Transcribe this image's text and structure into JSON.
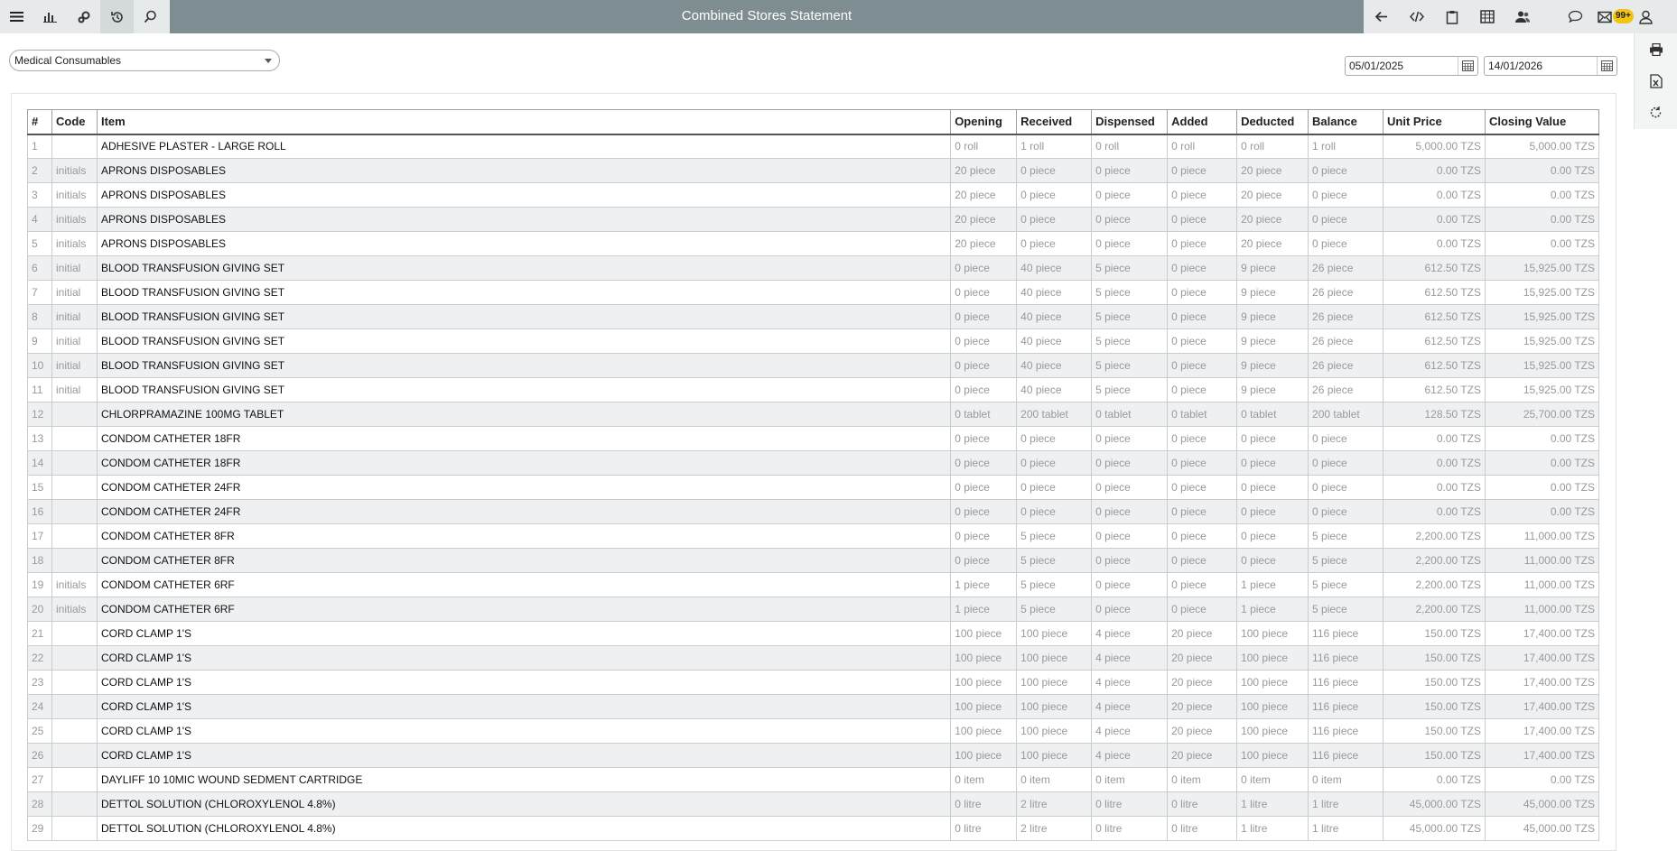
{
  "header": {
    "title": "Combined Stores Statement",
    "notification_count": "99+"
  },
  "filters": {
    "store": "Medical Consumables",
    "date_from": "05/01/2025",
    "date_to": "14/01/2026"
  },
  "table": {
    "columns": [
      "#",
      "Code",
      "Item",
      "Opening",
      "Received",
      "Dispensed",
      "Added",
      "Deducted",
      "Balance",
      "Unit Price",
      "Closing Value"
    ],
    "rows": [
      [
        "1",
        "",
        "ADHESIVE PLASTER - LARGE ROLL",
        "0 roll",
        "1 roll",
        "0 roll",
        "0 roll",
        "0 roll",
        "1 roll",
        "5,000.00 TZS",
        "5,000.00 TZS"
      ],
      [
        "2",
        "initials",
        "APRONS DISPOSABLES",
        "20 piece",
        "0 piece",
        "0 piece",
        "0 piece",
        "20 piece",
        "0 piece",
        "0.00 TZS",
        "0.00 TZS"
      ],
      [
        "3",
        "initials",
        "APRONS DISPOSABLES",
        "20 piece",
        "0 piece",
        "0 piece",
        "0 piece",
        "20 piece",
        "0 piece",
        "0.00 TZS",
        "0.00 TZS"
      ],
      [
        "4",
        "initials",
        "APRONS DISPOSABLES",
        "20 piece",
        "0 piece",
        "0 piece",
        "0 piece",
        "20 piece",
        "0 piece",
        "0.00 TZS",
        "0.00 TZS"
      ],
      [
        "5",
        "initials",
        "APRONS DISPOSABLES",
        "20 piece",
        "0 piece",
        "0 piece",
        "0 piece",
        "20 piece",
        "0 piece",
        "0.00 TZS",
        "0.00 TZS"
      ],
      [
        "6",
        "initial",
        "BLOOD TRANSFUSION GIVING SET",
        "0 piece",
        "40 piece",
        "5 piece",
        "0 piece",
        "9 piece",
        "26 piece",
        "612.50 TZS",
        "15,925.00 TZS"
      ],
      [
        "7",
        "initial",
        "BLOOD TRANSFUSION GIVING SET",
        "0 piece",
        "40 piece",
        "5 piece",
        "0 piece",
        "9 piece",
        "26 piece",
        "612.50 TZS",
        "15,925.00 TZS"
      ],
      [
        "8",
        "initial",
        "BLOOD TRANSFUSION GIVING SET",
        "0 piece",
        "40 piece",
        "5 piece",
        "0 piece",
        "9 piece",
        "26 piece",
        "612.50 TZS",
        "15,925.00 TZS"
      ],
      [
        "9",
        "initial",
        "BLOOD TRANSFUSION GIVING SET",
        "0 piece",
        "40 piece",
        "5 piece",
        "0 piece",
        "9 piece",
        "26 piece",
        "612.50 TZS",
        "15,925.00 TZS"
      ],
      [
        "10",
        "initial",
        "BLOOD TRANSFUSION GIVING SET",
        "0 piece",
        "40 piece",
        "5 piece",
        "0 piece",
        "9 piece",
        "26 piece",
        "612.50 TZS",
        "15,925.00 TZS"
      ],
      [
        "11",
        "initial",
        "BLOOD TRANSFUSION GIVING SET",
        "0 piece",
        "40 piece",
        "5 piece",
        "0 piece",
        "9 piece",
        "26 piece",
        "612.50 TZS",
        "15,925.00 TZS"
      ],
      [
        "12",
        "",
        "CHLORPRAMAZINE 100MG TABLET",
        "0 tablet",
        "200 tablet",
        "0 tablet",
        "0 tablet",
        "0 tablet",
        "200 tablet",
        "128.50 TZS",
        "25,700.00 TZS"
      ],
      [
        "13",
        "",
        "CONDOM CATHETER 18FR",
        "0 piece",
        "0 piece",
        "0 piece",
        "0 piece",
        "0 piece",
        "0 piece",
        "0.00 TZS",
        "0.00 TZS"
      ],
      [
        "14",
        "",
        "CONDOM CATHETER 18FR",
        "0 piece",
        "0 piece",
        "0 piece",
        "0 piece",
        "0 piece",
        "0 piece",
        "0.00 TZS",
        "0.00 TZS"
      ],
      [
        "15",
        "",
        "CONDOM CATHETER 24FR",
        "0 piece",
        "0 piece",
        "0 piece",
        "0 piece",
        "0 piece",
        "0 piece",
        "0.00 TZS",
        "0.00 TZS"
      ],
      [
        "16",
        "",
        "CONDOM CATHETER 24FR",
        "0 piece",
        "0 piece",
        "0 piece",
        "0 piece",
        "0 piece",
        "0 piece",
        "0.00 TZS",
        "0.00 TZS"
      ],
      [
        "17",
        "",
        "CONDOM CATHETER 8FR",
        "0 piece",
        "5 piece",
        "0 piece",
        "0 piece",
        "0 piece",
        "5 piece",
        "2,200.00 TZS",
        "11,000.00 TZS"
      ],
      [
        "18",
        "",
        "CONDOM CATHETER 8FR",
        "0 piece",
        "5 piece",
        "0 piece",
        "0 piece",
        "0 piece",
        "5 piece",
        "2,200.00 TZS",
        "11,000.00 TZS"
      ],
      [
        "19",
        "initials",
        "CONDOM CATHETER 6RF",
        "1 piece",
        "5 piece",
        "0 piece",
        "0 piece",
        "1 piece",
        "5 piece",
        "2,200.00 TZS",
        "11,000.00 TZS"
      ],
      [
        "20",
        "initials",
        "CONDOM CATHETER 6RF",
        "1 piece",
        "5 piece",
        "0 piece",
        "0 piece",
        "1 piece",
        "5 piece",
        "2,200.00 TZS",
        "11,000.00 TZS"
      ],
      [
        "21",
        "",
        "CORD CLAMP 1'S",
        "100 piece",
        "100 piece",
        "4 piece",
        "20 piece",
        "100 piece",
        "116 piece",
        "150.00 TZS",
        "17,400.00 TZS"
      ],
      [
        "22",
        "",
        "CORD CLAMP 1'S",
        "100 piece",
        "100 piece",
        "4 piece",
        "20 piece",
        "100 piece",
        "116 piece",
        "150.00 TZS",
        "17,400.00 TZS"
      ],
      [
        "23",
        "",
        "CORD CLAMP 1'S",
        "100 piece",
        "100 piece",
        "4 piece",
        "20 piece",
        "100 piece",
        "116 piece",
        "150.00 TZS",
        "17,400.00 TZS"
      ],
      [
        "24",
        "",
        "CORD CLAMP 1'S",
        "100 piece",
        "100 piece",
        "4 piece",
        "20 piece",
        "100 piece",
        "116 piece",
        "150.00 TZS",
        "17,400.00 TZS"
      ],
      [
        "25",
        "",
        "CORD CLAMP 1'S",
        "100 piece",
        "100 piece",
        "4 piece",
        "20 piece",
        "100 piece",
        "116 piece",
        "150.00 TZS",
        "17,400.00 TZS"
      ],
      [
        "26",
        "",
        "CORD CLAMP 1'S",
        "100 piece",
        "100 piece",
        "4 piece",
        "20 piece",
        "100 piece",
        "116 piece",
        "150.00 TZS",
        "17,400.00 TZS"
      ],
      [
        "27",
        "",
        "DAYLIFF 10 10MIC WOUND SEDMENT CARTRIDGE",
        "0 item",
        "0 item",
        "0 item",
        "0 item",
        "0 item",
        "0 item",
        "0.00 TZS",
        "0.00 TZS"
      ],
      [
        "28",
        "",
        "DETTOL SOLUTION (CHLOROXYLENOL 4.8%)",
        "0 litre",
        "2 litre",
        "0 litre",
        "0 litre",
        "1 litre",
        "1 litre",
        "45,000.00 TZS",
        "45,000.00 TZS"
      ],
      [
        "29",
        "",
        "DETTOL SOLUTION (CHLOROXYLENOL 4.8%)",
        "0 litre",
        "2 litre",
        "0 litre",
        "0 litre",
        "1 litre",
        "1 litre",
        "45,000.00 TZS",
        "45,000.00 TZS"
      ]
    ]
  }
}
